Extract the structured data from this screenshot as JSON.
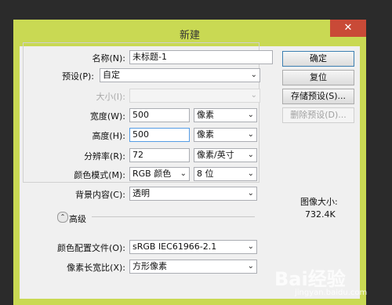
{
  "dialog": {
    "title": "新建",
    "close_icon": "close-icon"
  },
  "fields": {
    "name": {
      "label": "名称(N):",
      "value": "未标题-1"
    },
    "preset": {
      "label": "预设(P):",
      "value": "自定"
    },
    "size": {
      "label": "大小(I):",
      "value": ""
    },
    "width": {
      "label": "宽度(W):",
      "value": "500",
      "unit": "像素"
    },
    "height": {
      "label": "高度(H):",
      "value": "500",
      "unit": "像素"
    },
    "resolution": {
      "label": "分辨率(R):",
      "value": "72",
      "unit": "像素/英寸"
    },
    "color_mode": {
      "label": "颜色模式(M):",
      "value": "RGB 颜色",
      "bits": "8 位"
    },
    "background": {
      "label": "背景内容(C):",
      "value": "透明"
    },
    "advanced": {
      "label": "高级"
    },
    "color_profile": {
      "label": "颜色配置文件(O):",
      "value": "sRGB IEC61966-2.1"
    },
    "pixel_aspect": {
      "label": "像素长宽比(X):",
      "value": "方形像素"
    }
  },
  "buttons": {
    "ok": "确定",
    "reset": "复位",
    "save_preset": "存储预设(S)...",
    "delete_preset": "删除预设(D)..."
  },
  "image_size": {
    "label": "图像大小:",
    "value": "732.4K"
  },
  "watermark": {
    "logo": "Bai经验",
    "url": "jingyan.baidu.com"
  }
}
